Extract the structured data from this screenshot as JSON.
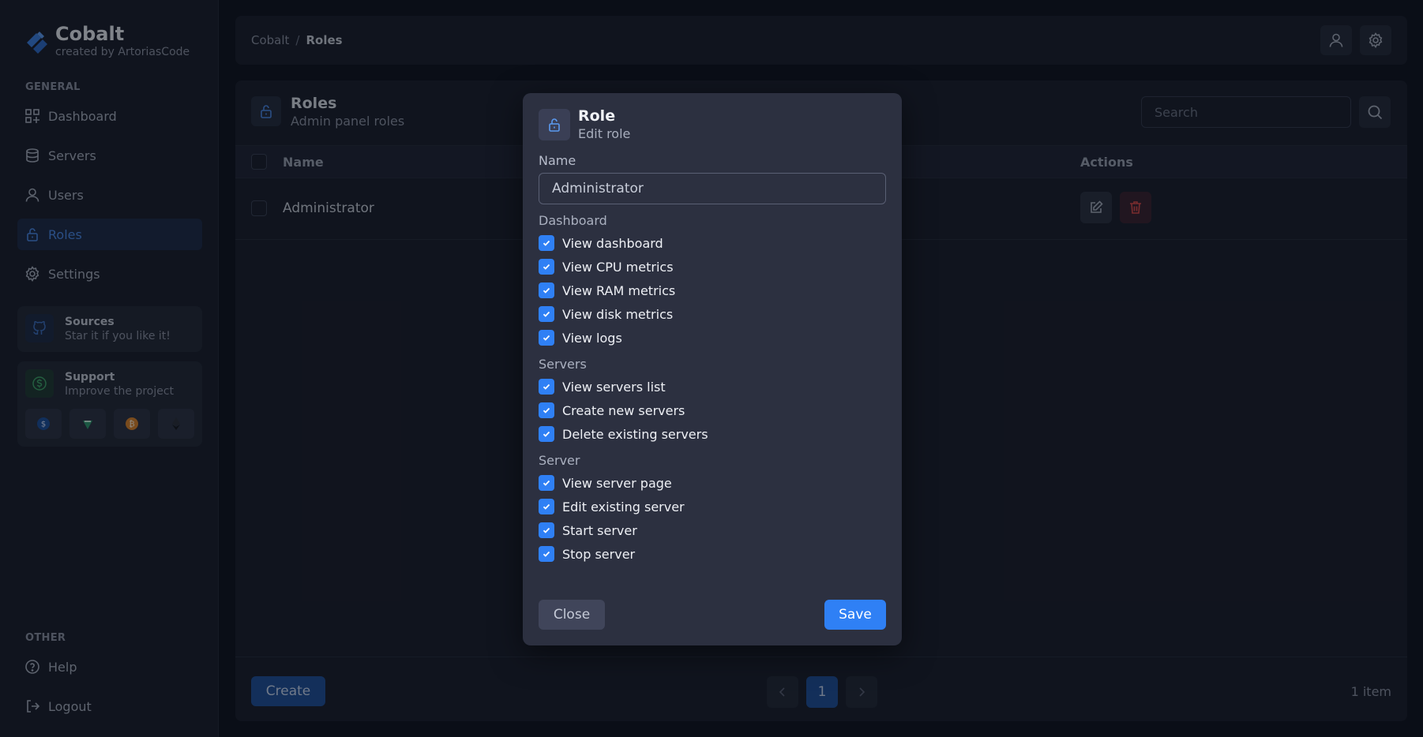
{
  "brand": {
    "name": "Cobalt",
    "subtitle": "created by ArtoriasCode"
  },
  "sidebar": {
    "general_label": "GENERAL",
    "items": [
      {
        "label": "Dashboard",
        "icon": "dashboard-icon"
      },
      {
        "label": "Servers",
        "icon": "database-icon"
      },
      {
        "label": "Users",
        "icon": "user-icon"
      },
      {
        "label": "Roles",
        "icon": "lock-icon",
        "active": true
      },
      {
        "label": "Settings",
        "icon": "gear-icon"
      }
    ],
    "sources": {
      "title": "Sources",
      "subtitle": "Star it if you like it!",
      "icon": "github-icon"
    },
    "support": {
      "title": "Support",
      "subtitle": "Improve the project",
      "icon": "dollar-icon",
      "coins": [
        "usdc-icon",
        "tether-icon",
        "bitcoin-icon",
        "ethereum-icon"
      ]
    },
    "other_label": "OTHER",
    "other_items": [
      {
        "label": "Help",
        "icon": "help-icon"
      },
      {
        "label": "Logout",
        "icon": "logout-icon"
      }
    ]
  },
  "topbar": {
    "breadcrumb": {
      "root": "Cobalt",
      "separator": "/",
      "current": "Roles"
    },
    "icons": [
      "user-icon",
      "gear-icon"
    ]
  },
  "main": {
    "title": "Roles",
    "subtitle": "Admin panel roles",
    "search": {
      "placeholder": "Search",
      "value": ""
    },
    "table": {
      "columns": {
        "name": "Name",
        "actions": "Actions"
      },
      "rows": [
        {
          "name": "Administrator"
        }
      ]
    },
    "footer": {
      "create_label": "Create",
      "current_page": "1",
      "item_count": "1 item"
    }
  },
  "modal": {
    "title": "Role",
    "subtitle": "Edit role",
    "name_label": "Name",
    "name_value": "Administrator",
    "groups": [
      {
        "label": "Dashboard",
        "permissions": [
          {
            "label": "View dashboard",
            "checked": true
          },
          {
            "label": "View CPU metrics",
            "checked": true
          },
          {
            "label": "View RAM metrics",
            "checked": true
          },
          {
            "label": "View disk metrics",
            "checked": true
          },
          {
            "label": "View logs",
            "checked": true
          }
        ]
      },
      {
        "label": "Servers",
        "permissions": [
          {
            "label": "View servers list",
            "checked": true
          },
          {
            "label": "Create new servers",
            "checked": true
          },
          {
            "label": "Delete existing servers",
            "checked": true
          }
        ]
      },
      {
        "label": "Server",
        "permissions": [
          {
            "label": "View server page",
            "checked": true
          },
          {
            "label": "Edit existing server",
            "checked": true
          },
          {
            "label": "Start server",
            "checked": true
          },
          {
            "label": "Stop server",
            "checked": true
          }
        ]
      }
    ],
    "close_label": "Close",
    "save_label": "Save"
  },
  "colors": {
    "accent": "#2f80f5",
    "active_nav": "#4a88e8",
    "danger": "#d94a4a",
    "background": "#0f1320",
    "surface": "#1a1e2c",
    "modal": "#2c3040"
  }
}
